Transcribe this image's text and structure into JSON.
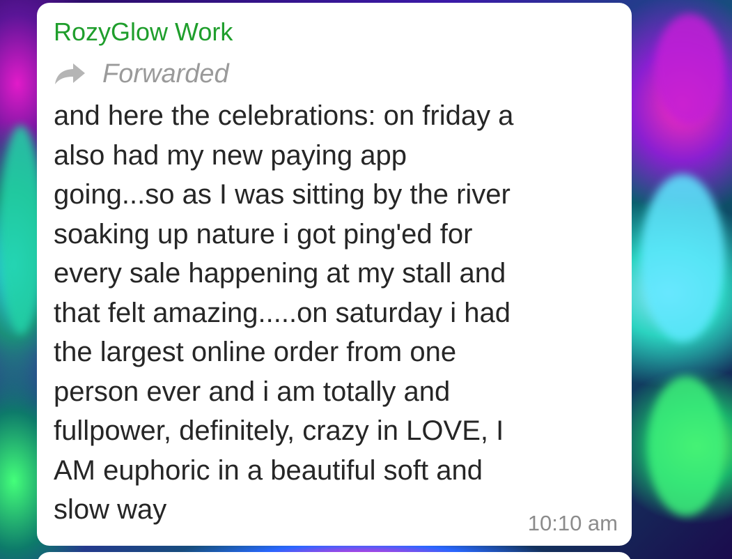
{
  "message": {
    "sender": "RozyGlow Work",
    "forwarded_label": "Forwarded",
    "forward_icon": "forward-arrow-icon",
    "lines": [
      "and here the celebrations: on friday a",
      "also had my new paying app",
      "going...so as I was sitting by the river",
      "soaking up nature i got ping'ed for",
      "every sale happening at my stall and",
      "that felt amazing.....on saturday i had",
      "the largest online order from one",
      "person ever and i am totally and",
      "fullpower, definitely, crazy in LOVE, I",
      "AM euphoric in a beautiful soft and",
      "slow way"
    ],
    "timestamp": "10:10 am"
  },
  "colors": {
    "sender_name": "#1f9e2c",
    "bubble_background": "#ffffff",
    "message_text": "#262626",
    "meta_text": "#8c8c8c"
  }
}
